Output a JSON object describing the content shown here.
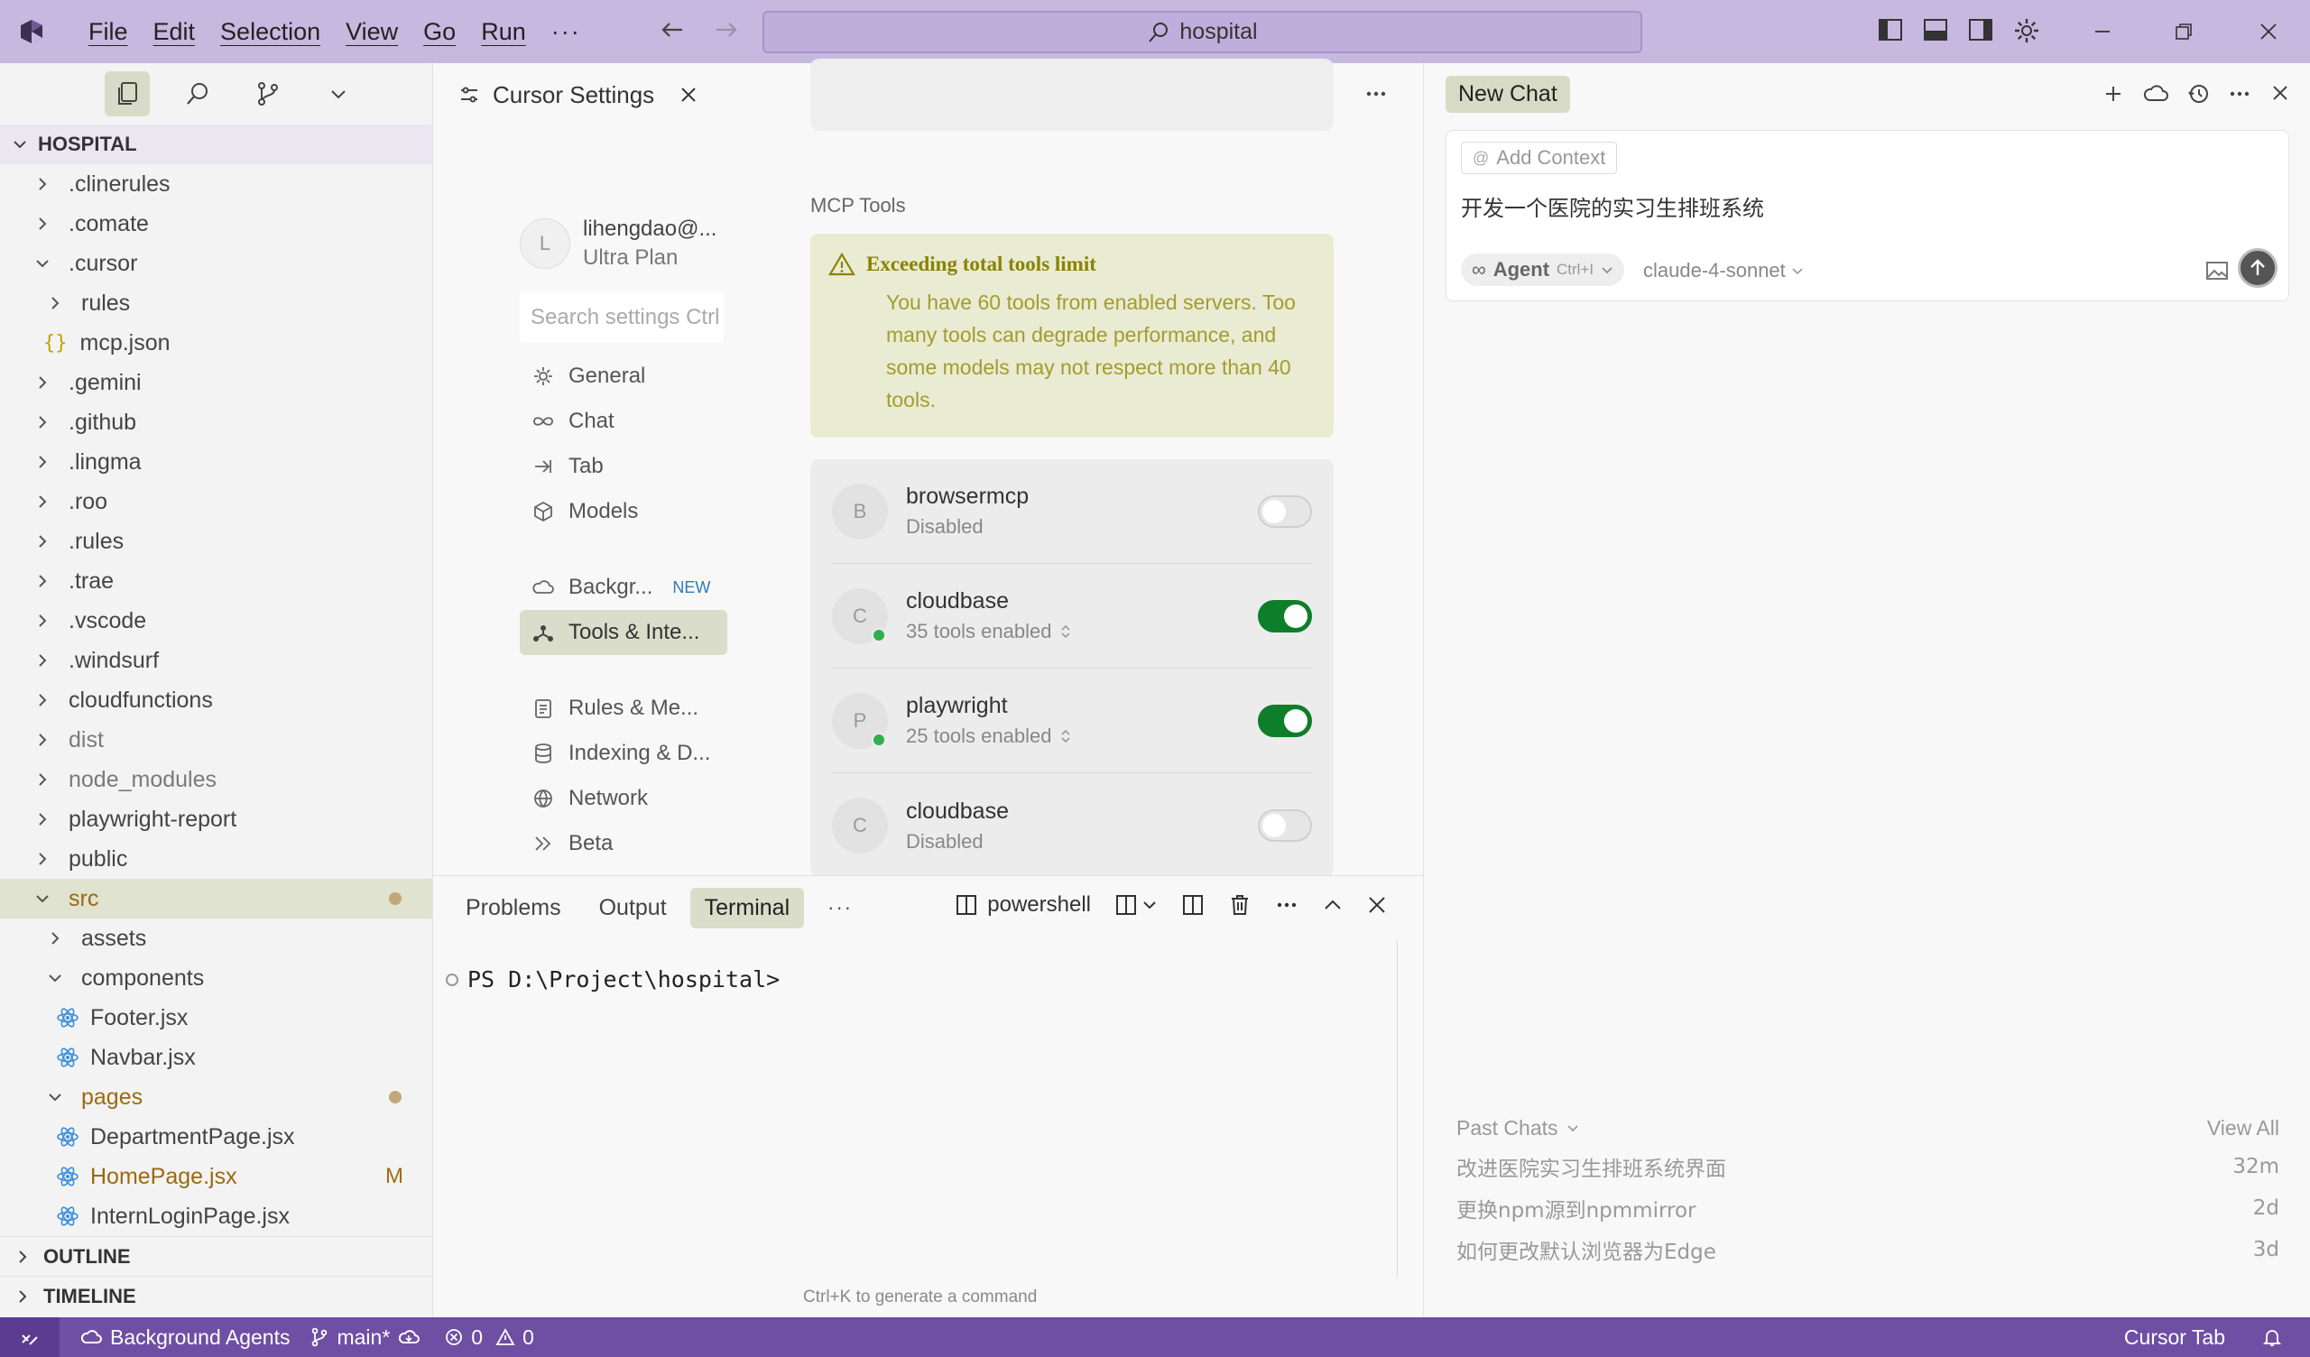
{
  "titlebar": {
    "menu": [
      "File",
      "Edit",
      "Selection",
      "View",
      "Go",
      "Run"
    ],
    "more": "···",
    "search": "hospital"
  },
  "explorer": {
    "root": "HOSPITAL",
    "items": [
      {
        "label": ".clinerules",
        "kind": "folder",
        "open": false,
        "depth": 0
      },
      {
        "label": ".comate",
        "kind": "folder",
        "open": false,
        "depth": 0
      },
      {
        "label": ".cursor",
        "kind": "folder",
        "open": true,
        "depth": 0
      },
      {
        "label": "rules",
        "kind": "folder",
        "open": false,
        "depth": 1
      },
      {
        "label": "mcp.json",
        "kind": "json",
        "depth": 1
      },
      {
        "label": ".gemini",
        "kind": "folder",
        "open": false,
        "depth": 0
      },
      {
        "label": ".github",
        "kind": "folder",
        "open": false,
        "depth": 0
      },
      {
        "label": ".lingma",
        "kind": "folder",
        "open": false,
        "depth": 0
      },
      {
        "label": ".roo",
        "kind": "folder",
        "open": false,
        "depth": 0
      },
      {
        "label": ".rules",
        "kind": "folder",
        "open": false,
        "depth": 0
      },
      {
        "label": ".trae",
        "kind": "folder",
        "open": false,
        "depth": 0
      },
      {
        "label": ".vscode",
        "kind": "folder",
        "open": false,
        "depth": 0
      },
      {
        "label": ".windsurf",
        "kind": "folder",
        "open": false,
        "depth": 0
      },
      {
        "label": "cloudfunctions",
        "kind": "folder",
        "open": false,
        "depth": 0
      },
      {
        "label": "dist",
        "kind": "folder",
        "open": false,
        "depth": 0,
        "dim": true
      },
      {
        "label": "node_modules",
        "kind": "folder",
        "open": false,
        "depth": 0,
        "dim": true
      },
      {
        "label": "playwright-report",
        "kind": "folder",
        "open": false,
        "depth": 0
      },
      {
        "label": "public",
        "kind": "folder",
        "open": false,
        "depth": 0
      },
      {
        "label": "src",
        "kind": "folder",
        "open": true,
        "depth": 0,
        "selected": true,
        "dot": true,
        "modified": true
      },
      {
        "label": "assets",
        "kind": "folder",
        "open": false,
        "depth": 1
      },
      {
        "label": "components",
        "kind": "folder",
        "open": true,
        "depth": 1
      },
      {
        "label": "Footer.jsx",
        "kind": "react",
        "depth": 2
      },
      {
        "label": "Navbar.jsx",
        "kind": "react",
        "depth": 2
      },
      {
        "label": "pages",
        "kind": "folder",
        "open": true,
        "depth": 1,
        "dot": true,
        "modified": true
      },
      {
        "label": "DepartmentPage.jsx",
        "kind": "react",
        "depth": 2
      },
      {
        "label": "HomePage.jsx",
        "kind": "react",
        "depth": 2,
        "badge": "M",
        "modified": true
      },
      {
        "label": "InternLoginPage.jsx",
        "kind": "react",
        "depth": 2
      }
    ],
    "outline": "OUTLINE",
    "timeline": "TIMELINE"
  },
  "editor": {
    "tab_title": "Cursor Settings",
    "account": {
      "initial": "L",
      "email": "lihengdao@...",
      "plan": "Ultra Plan"
    },
    "search_placeholder": "Search settings Ctrl",
    "nav": [
      {
        "label": "General",
        "icon": "gear-icon"
      },
      {
        "label": "Chat",
        "icon": "infinity-icon"
      },
      {
        "label": "Tab",
        "icon": "arrow-tab-icon"
      },
      {
        "label": "Models",
        "icon": "cube-icon"
      },
      {
        "label": "Backgr...",
        "icon": "cloud-icon",
        "badge": "NEW",
        "gap_before": true
      },
      {
        "label": "Tools & Inte...",
        "icon": "tools-icon",
        "active": true
      },
      {
        "label": "Rules & Me...",
        "icon": "clipboard-icon",
        "gap_before": true
      },
      {
        "label": "Indexing & D...",
        "icon": "database-icon"
      },
      {
        "label": "Network",
        "icon": "globe-icon"
      },
      {
        "label": "Beta",
        "icon": "double-chevron-icon"
      }
    ],
    "mcp": {
      "section_title": "MCP Tools",
      "warning_title": "Exceeding total tools limit",
      "warning_body": "You have 60 tools from enabled servers. Too many tools can degrade performance, and some models may not respect more than 40 tools.",
      "tools": [
        {
          "initial": "B",
          "name": "browsermcp",
          "status": "Disabled",
          "enabled": false,
          "green_dot": false
        },
        {
          "initial": "C",
          "name": "cloudbase",
          "status": "35 tools enabled",
          "enabled": true,
          "green_dot": true
        },
        {
          "initial": "P",
          "name": "playwright",
          "status": "25 tools enabled",
          "enabled": true,
          "green_dot": true
        },
        {
          "initial": "C",
          "name": "cloudbase",
          "status": "Disabled",
          "enabled": false,
          "green_dot": false
        }
      ]
    }
  },
  "panel": {
    "tabs": [
      "Problems",
      "Output",
      "Terminal"
    ],
    "active_tab": "Terminal",
    "more": "···",
    "shell": "powershell",
    "prompt": "PS D:\\Project\\hospital>",
    "hint": "Ctrl+K to generate a command"
  },
  "chat": {
    "tab": "New Chat",
    "add_context": "Add Context",
    "input_text": "开发一个医院的实习生排班系统",
    "agent_label": "Agent",
    "agent_shortcut": "Ctrl+I",
    "model": "claude-4-sonnet",
    "past_label": "Past Chats",
    "view_all": "View All",
    "past": [
      {
        "title": "改进医院实习生排班系统界面",
        "time": "32m"
      },
      {
        "title": "更换npm源到npmmirror",
        "time": "2d"
      },
      {
        "title": "如何更改默认浏览器为Edge",
        "time": "3d"
      }
    ]
  },
  "statusbar": {
    "agents": "Background Agents",
    "branch": "main*",
    "errors": "0",
    "warnings": "0",
    "cursor_tab": "Cursor Tab"
  }
}
